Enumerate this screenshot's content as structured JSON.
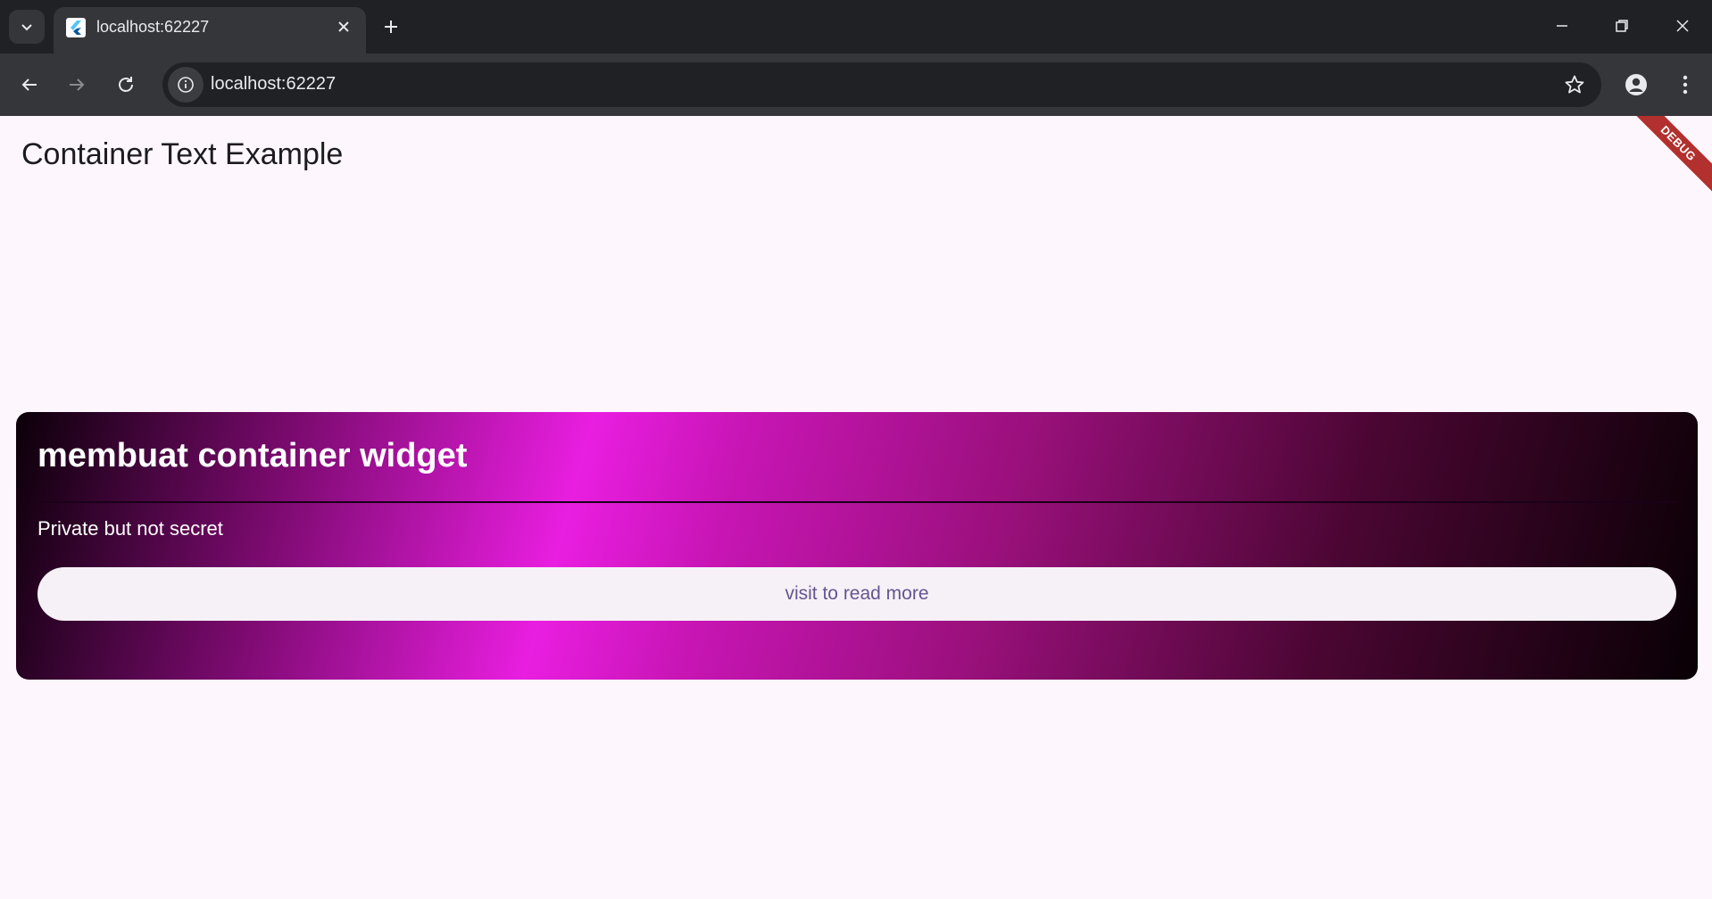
{
  "browser": {
    "tab_title": "localhost:62227",
    "url": "localhost:62227"
  },
  "app": {
    "title": "Container Text Example",
    "debug_banner": "DEBUG"
  },
  "card": {
    "heading": "membuat container widget",
    "subtitle": "Private but not secret",
    "button_label": "visit to read more"
  }
}
